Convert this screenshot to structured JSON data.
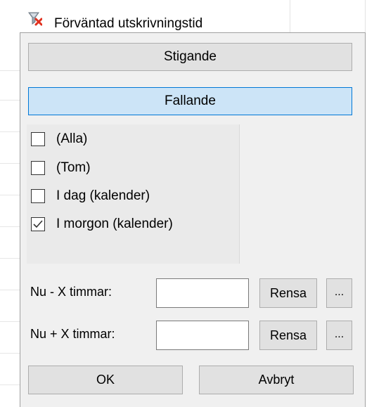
{
  "header": {
    "title": "Förväntad utskrivningstid",
    "icon": "filter-funnel-icon"
  },
  "sort": {
    "ascending_label": "Stigande",
    "descending_label": "Fallande"
  },
  "filter_list": {
    "items": [
      {
        "label": "(Alla)",
        "checked": false
      },
      {
        "label": "(Tom)",
        "checked": false
      },
      {
        "label": "I dag (kalender)",
        "checked": false
      },
      {
        "label": "I morgon (kalender)",
        "checked": true
      }
    ]
  },
  "hours_minus": {
    "label": "Nu - X timmar:",
    "value": "",
    "clear_label": "Rensa",
    "more_label": "..."
  },
  "hours_plus": {
    "label": "Nu + X timmar:",
    "value": "",
    "clear_label": "Rensa",
    "more_label": "..."
  },
  "footer": {
    "ok_label": "OK",
    "cancel_label": "Avbryt"
  },
  "colors": {
    "selected_button_bg": "#cce4f7",
    "selected_button_border": "#0078d7",
    "panel_bg": "#f0f0f0"
  }
}
